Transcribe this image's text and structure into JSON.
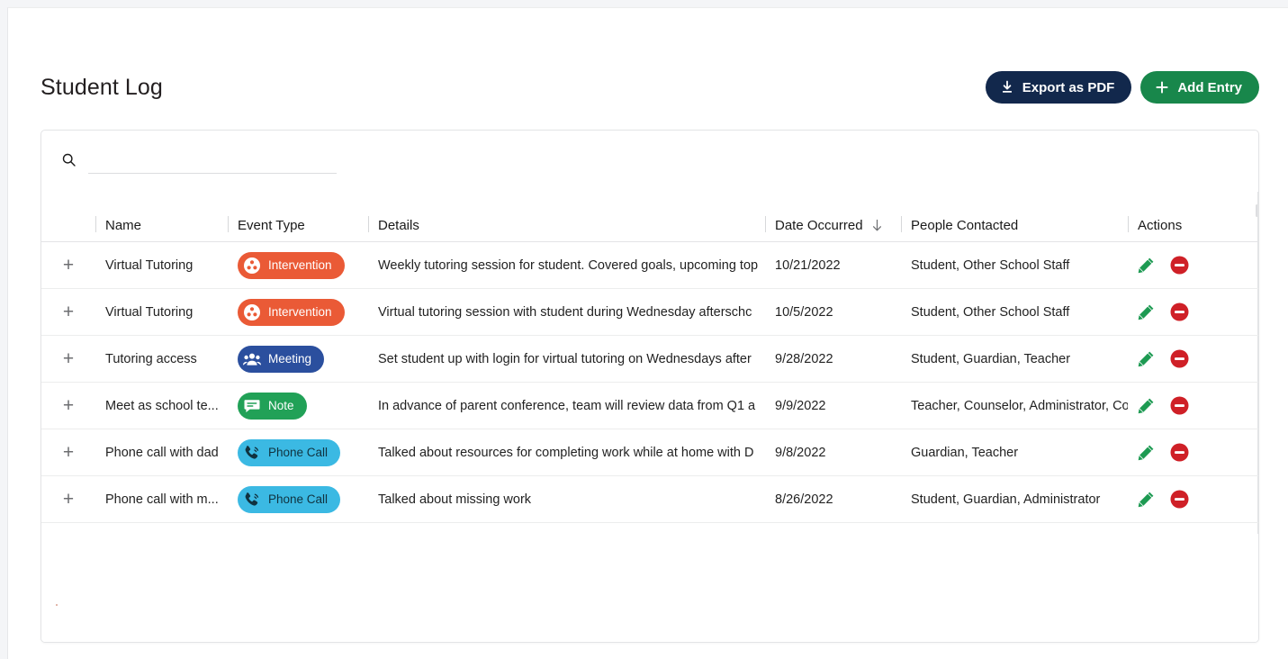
{
  "header": {
    "title": "Student Log",
    "export_label": "Export as PDF",
    "add_label": "Add Entry",
    "export_icon": "download-icon",
    "add_icon": "plus-icon"
  },
  "search": {
    "value": "",
    "placeholder": "",
    "icon": "search-icon"
  },
  "table": {
    "columns": [
      {
        "key": "expand",
        "label": ""
      },
      {
        "key": "name",
        "label": "Name"
      },
      {
        "key": "event_type",
        "label": "Event Type"
      },
      {
        "key": "details",
        "label": "Details"
      },
      {
        "key": "date_occurred",
        "label": "Date Occurred",
        "sort": "desc",
        "sort_icon": "arrow-down-icon"
      },
      {
        "key": "people_contacted",
        "label": "People Contacted"
      },
      {
        "key": "actions",
        "label": "Actions"
      }
    ],
    "row_actions": {
      "edit_icon": "pencil-icon",
      "delete_icon": "minus-circle-icon"
    },
    "expand_icon": "plus-icon",
    "rows": [
      {
        "name": "Virtual Tutoring",
        "event_type": "Intervention",
        "event_type_key": "intervention",
        "event_icon": "intervention-group-icon",
        "details": "Weekly tutoring session for student. Covered goals, upcoming top",
        "date_occurred": "10/21/2022",
        "people_contacted": "Student, Other School Staff"
      },
      {
        "name": "Virtual Tutoring",
        "event_type": "Intervention",
        "event_type_key": "intervention",
        "event_icon": "intervention-group-icon",
        "details": "Virtual tutoring session with student during Wednesday afterschc",
        "date_occurred": "10/5/2022",
        "people_contacted": "Student, Other School Staff"
      },
      {
        "name": "Tutoring access",
        "event_type": "Meeting",
        "event_type_key": "meeting",
        "event_icon": "people-icon",
        "details": "Set student up with login for virtual tutoring on Wednesdays after",
        "date_occurred": "9/28/2022",
        "people_contacted": "Student, Guardian, Teacher"
      },
      {
        "name": "Meet as school te...",
        "event_type": "Note",
        "event_type_key": "note",
        "event_icon": "note-icon",
        "details": "In advance of parent conference, team will review data from Q1 a",
        "date_occurred": "9/9/2022",
        "people_contacted": "Teacher, Counselor, Administrator, Co"
      },
      {
        "name": "Phone call with dad",
        "event_type": "Phone Call",
        "event_type_key": "phone",
        "event_icon": "phone-icon",
        "details": "Talked about resources for completing work while at home with D",
        "date_occurred": "9/8/2022",
        "people_contacted": "Guardian, Teacher"
      },
      {
        "name": "Phone call with m...",
        "event_type": "Phone Call",
        "event_type_key": "phone",
        "event_icon": "phone-icon",
        "details": "Talked about missing work",
        "date_occurred": "8/26/2022",
        "people_contacted": "Student, Guardian, Administrator"
      }
    ]
  },
  "colors": {
    "navy": "#12284c",
    "green": "#18874b",
    "intervention": "#ea5a36",
    "meeting": "#2b4f9e",
    "note": "#21a157",
    "phone": "#3bb9e3",
    "edit": "#21a157",
    "delete": "#cf2027"
  }
}
